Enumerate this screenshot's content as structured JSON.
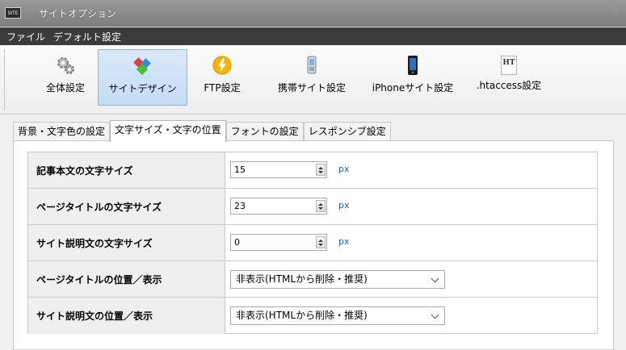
{
  "window": {
    "title": "サイトオプション",
    "close": "✕",
    "app_icon_text": "SITE"
  },
  "menu": [
    "ファイル",
    "デフォルト設定"
  ],
  "toolbar": {
    "items": [
      {
        "label": "全体設定",
        "icon": "gear-icon"
      },
      {
        "label": "サイトデザイン",
        "icon": "design-icon"
      },
      {
        "label": "FTP設定",
        "icon": "lightning-icon"
      },
      {
        "label": "携帯サイト設定",
        "icon": "mobile-phone-icon"
      },
      {
        "label": "iPhoneサイト設定",
        "icon": "iphone-icon"
      },
      {
        "label": ".htaccess設定",
        "icon": "htaccess-icon",
        "icon_text": "HT"
      }
    ],
    "active_index": 1
  },
  "tabs": [
    "背景・文字色の設定",
    "文字サイズ・文字の位置",
    "フォントの設定",
    "レスポンシブ設定"
  ],
  "selected_tab": 1,
  "settings": {
    "body_text_size": {
      "label": "記事本文の文字サイズ",
      "value": "15",
      "unit": "px"
    },
    "page_title_size": {
      "label": "ページタイトルの文字サイズ",
      "value": "23",
      "unit": "px"
    },
    "site_desc_size": {
      "label": "サイト説明文の文字サイズ",
      "value": "0",
      "unit": "px"
    },
    "page_title_position": {
      "label": "ページタイトルの位置／表示",
      "value": "非表示(HTMLから削除・推奨)"
    },
    "site_desc_position": {
      "label": "サイト説明文の位置／表示",
      "value": "非表示(HTMLから削除・推奨)"
    }
  },
  "colors": {
    "accent": "#1f5fb4",
    "active_button": "#c4dcf4",
    "menubar": "#3b3b3b"
  }
}
